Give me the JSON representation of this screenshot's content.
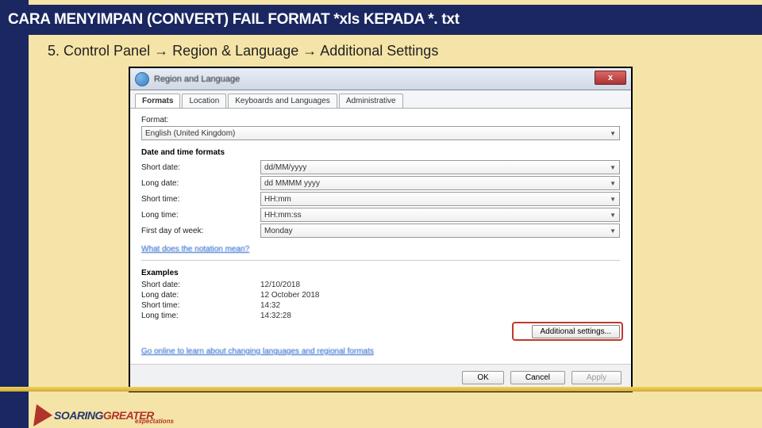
{
  "slide": {
    "title": "CARA MENYIMPAN (CONVERT) FAIL FORMAT *xls KEPADA *. txt",
    "subtitle": "5. Control Panel → Region & Language → Additional Settings"
  },
  "dialog": {
    "windowTitle": "Region and Language",
    "closeLabel": "x",
    "tabs": {
      "formats": "Formats",
      "location": "Location",
      "keyboards": "Keyboards and Languages",
      "admin": "Administrative"
    },
    "formatLabel": "Format:",
    "formatValue": "English (United Kingdom)",
    "dtGroup": "Date and time formats",
    "rows": {
      "shortDate": {
        "label": "Short date:",
        "value": "dd/MM/yyyy"
      },
      "longDate": {
        "label": "Long date:",
        "value": "dd MMMM yyyy"
      },
      "shortTime": {
        "label": "Short time:",
        "value": "HH:mm"
      },
      "longTime": {
        "label": "Long time:",
        "value": "HH:mm:ss"
      },
      "firstDay": {
        "label": "First day of week:",
        "value": "Monday"
      }
    },
    "notationLink": "What does the notation mean?",
    "examplesTitle": "Examples",
    "examples": {
      "shortDate": {
        "label": "Short date:",
        "value": "12/10/2018"
      },
      "longDate": {
        "label": "Long date:",
        "value": "12 October 2018"
      },
      "shortTime": {
        "label": "Short time:",
        "value": "14:32"
      },
      "longTime": {
        "label": "Long time:",
        "value": "14:32:28"
      }
    },
    "additionalBtn": "Additional settings...",
    "onlineLink": "Go online to learn about changing languages and regional formats",
    "buttons": {
      "ok": "OK",
      "cancel": "Cancel",
      "apply": "Apply"
    }
  },
  "logo": {
    "soaring": "SOARING",
    "greater": "GREATER",
    "sub": "expectations"
  }
}
